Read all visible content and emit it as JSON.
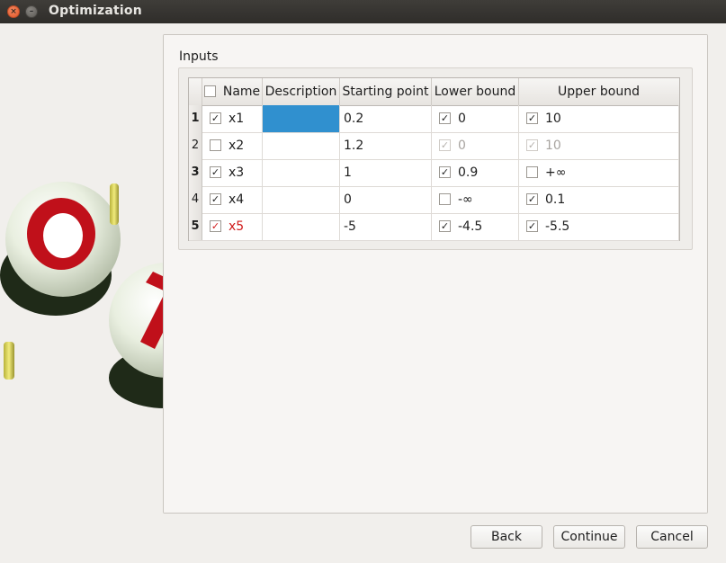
{
  "window": {
    "title": "Optimization"
  },
  "inputs_group": {
    "label": "Inputs"
  },
  "table": {
    "headers": {
      "name": "Name",
      "description": "Description",
      "starting_point": "Starting point",
      "lower_bound": "Lower bound",
      "upper_bound": "Upper bound"
    },
    "rows": [
      {
        "index": "1",
        "name": "x1",
        "name_checked": true,
        "description": "",
        "start": "0.2",
        "lower": "0",
        "lower_checked": true,
        "upper": "10",
        "upper_checked": true
      },
      {
        "index": "2",
        "name": "x2",
        "name_checked": false,
        "description": "",
        "start": "1.2",
        "lower": "0",
        "lower_checked": true,
        "upper": "10",
        "upper_checked": true
      },
      {
        "index": "3",
        "name": "x3",
        "name_checked": true,
        "description": "",
        "start": "1",
        "lower": "0.9",
        "lower_checked": true,
        "upper": "+∞",
        "upper_checked": false
      },
      {
        "index": "4",
        "name": "x4",
        "name_checked": true,
        "description": "",
        "start": "0",
        "lower": "-∞",
        "lower_checked": false,
        "upper": "0.1",
        "upper_checked": true
      },
      {
        "index": "5",
        "name": "x5",
        "name_checked": true,
        "description": "",
        "start": "-5",
        "lower": "-4.5",
        "lower_checked": true,
        "upper": "-5.5",
        "upper_checked": true
      }
    ]
  },
  "buttons": {
    "back": "Back",
    "continue": "Continue",
    "cancel": "Cancel"
  },
  "colors": {
    "selection": "#3090cf",
    "error_text": "#d01818",
    "titlebar": "#3a3835"
  }
}
